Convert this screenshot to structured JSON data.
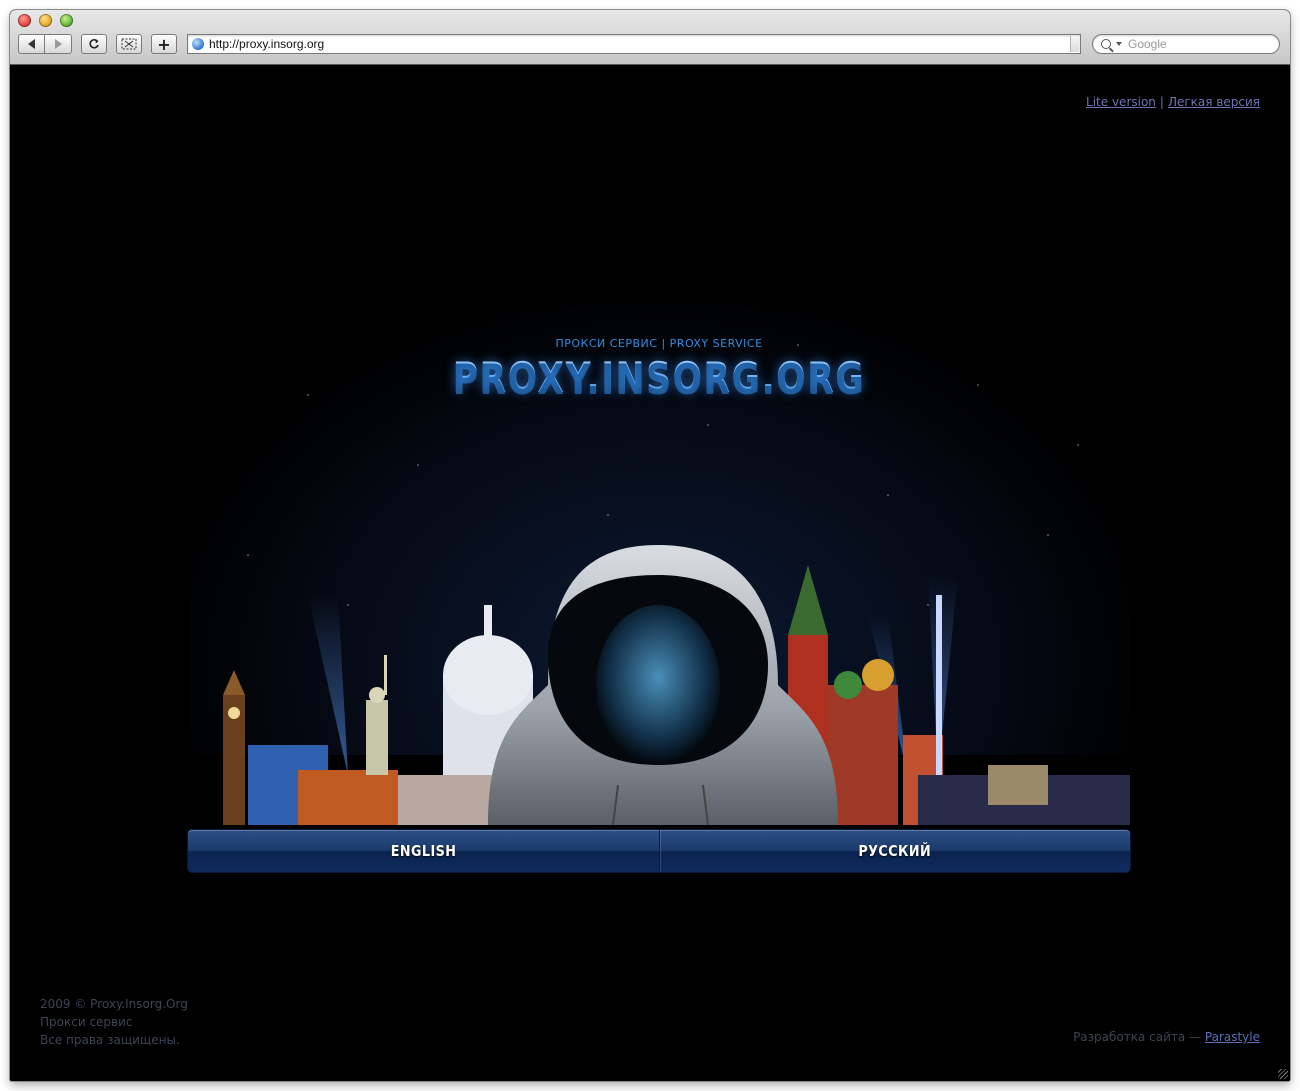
{
  "browser": {
    "back_label": "",
    "forward_label": "",
    "reload_icon": "reload-icon",
    "url": "http://proxy.insorg.org",
    "search_placeholder": "Google"
  },
  "page": {
    "top_links": {
      "lite": "Lite version",
      "separator": "|",
      "lite_ru": "Легкая версия"
    },
    "subtitle": "ПРОКСИ СЕРВИС | PROXY SERVICE",
    "logo": "PROXY.INSORG.ORG",
    "lang_english": "ENGLISH",
    "lang_russian": "РУССКИЙ",
    "footer_left": {
      "line1": "2009 ©  Proxy.Insorg.Org",
      "line2": "Прокси сервис",
      "line3": "Все права защищены."
    },
    "footer_right": {
      "text": "Разработка сайта — ",
      "link": "Parastyle"
    }
  },
  "colors": {
    "accent": "#2f8fe0",
    "logo": "#6fb6f0",
    "link": "#6f74b4",
    "bar": "#1c3b6c"
  }
}
